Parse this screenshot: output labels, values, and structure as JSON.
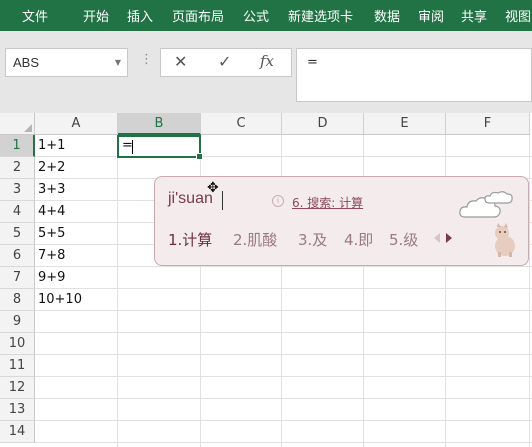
{
  "ribbon": {
    "tabs": [
      "文件",
      "开始",
      "插入",
      "页面布局",
      "公式",
      "新建选项卡",
      "数据",
      "审阅",
      "共享",
      "视图"
    ]
  },
  "formula_bar": {
    "name_box": "ABS",
    "cancel_symbol": "✕",
    "enter_symbol": "✓",
    "fx_symbol": "fx",
    "content": "="
  },
  "grid": {
    "columns": [
      "A",
      "B",
      "C",
      "D",
      "E",
      "F"
    ],
    "selected_column": "B",
    "rows": [
      "1",
      "2",
      "3",
      "4",
      "5",
      "6",
      "7",
      "8",
      "9",
      "10",
      "11",
      "12",
      "13",
      "14"
    ],
    "selected_row": "1",
    "column_a_values": [
      "1+1",
      "2+2",
      "3+3",
      "4+4",
      "5+5",
      "7+8",
      "9+9",
      "10+10"
    ],
    "active_cell": {
      "ref": "B1",
      "value": "="
    }
  },
  "ime": {
    "pinyin": "ji'suan",
    "search_hint": "6. 搜索: 计算",
    "candidates": [
      "1.计算",
      "2.肌酸",
      "3.及",
      "4.即",
      "5.级"
    ]
  },
  "colors": {
    "excel_green": "#217346",
    "ime_background": "#f4ecec",
    "ime_border": "#c9a9ae"
  }
}
